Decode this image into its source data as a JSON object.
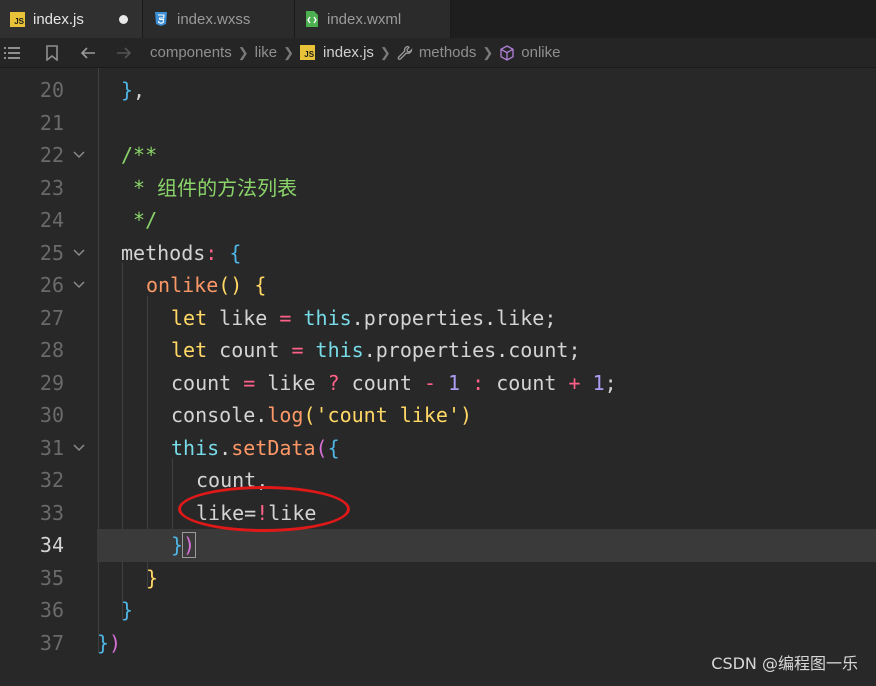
{
  "tabs": [
    {
      "label": "index.js",
      "icon": "js-file-icon",
      "active": true,
      "modified": true
    },
    {
      "label": "index.wxss",
      "icon": "css-file-icon",
      "active": false
    },
    {
      "label": "index.wxml",
      "icon": "wxml-file-icon",
      "active": false
    }
  ],
  "breadcrumb": {
    "items": [
      "components",
      "like",
      "index.js",
      "methods",
      "onlike"
    ],
    "icons": [
      "list-icon",
      "bookmark-icon",
      "back-arrow-icon",
      "forward-arrow-icon"
    ]
  },
  "editor": {
    "current_line": 34,
    "lines": [
      {
        "n": "20",
        "text": "},"
      },
      {
        "n": "21",
        "text": ""
      },
      {
        "n": "22",
        "text": "/**",
        "foldable": true
      },
      {
        "n": "23",
        "text": " * 组件的方法列表"
      },
      {
        "n": "24",
        "text": " */"
      },
      {
        "n": "25",
        "text": "methods: {",
        "foldable": true
      },
      {
        "n": "26",
        "text": "onlike() {",
        "foldable": true
      },
      {
        "n": "27",
        "text": "let like = this.properties.like;"
      },
      {
        "n": "28",
        "text": "let count = this.properties.count;"
      },
      {
        "n": "29",
        "text": "count = like ? count - 1 : count + 1;"
      },
      {
        "n": "30",
        "text": "console.log('count like')"
      },
      {
        "n": "31",
        "text": "this.setData({",
        "foldable": true
      },
      {
        "n": "32",
        "text": "count,"
      },
      {
        "n": "33",
        "text": "like=!like"
      },
      {
        "n": "34",
        "text": "})"
      },
      {
        "n": "35",
        "text": "}"
      },
      {
        "n": "36",
        "text": "}"
      },
      {
        "n": "37",
        "text": "})"
      }
    ]
  },
  "watermark": "CSDN @编程图一乐",
  "colors": {
    "keyword": "#ffd866",
    "this": "#78dce8",
    "function": "#fc9867",
    "number": "#ab9df2",
    "operator": "#ff6188",
    "comment": "#8ad46a",
    "annotation": "#e01818"
  }
}
